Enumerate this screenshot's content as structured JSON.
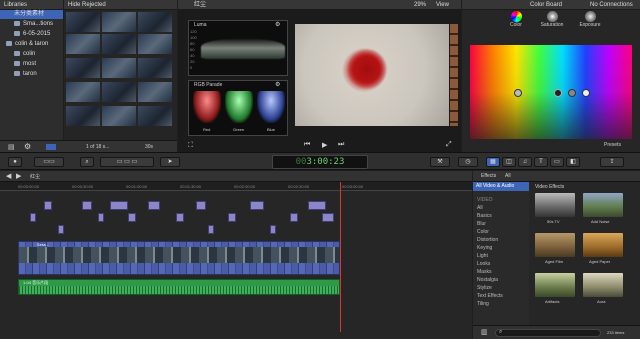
{
  "libraries": {
    "title": "Libraries",
    "items": [
      {
        "label": "未分类素材",
        "selected": true
      },
      {
        "label": "Sma...tions"
      },
      {
        "label": "Smart Collections"
      },
      {
        "label": "6-05-2015"
      },
      {
        "label": "colin & taron"
      },
      {
        "label": "colin"
      },
      {
        "label": "most"
      },
      {
        "label": "taron"
      }
    ]
  },
  "browser": {
    "filter": "Hide Rejected",
    "status": "1 of 18 s...",
    "duration": "30s"
  },
  "viewer": {
    "title": "红尘",
    "zoom": "29%",
    "view": "View",
    "luma_label": "Luma",
    "rgb_label": "RGB Parade",
    "scope_view": "View",
    "parade": [
      "Red",
      "Green",
      "Blue"
    ],
    "scale": [
      "120",
      "100",
      "80",
      "60",
      "40",
      "20",
      "0",
      "-20"
    ]
  },
  "color_board": {
    "title": "Color Board",
    "connections": "No Connections",
    "tabs": [
      "Color",
      "Saturation",
      "Exposure"
    ],
    "presets": "Presets"
  },
  "toolbar": {
    "timecode": "3:00:23",
    "timecode_prefix": "00",
    "timecode_labels": [
      "HR",
      "MIN",
      "SEC",
      "FR"
    ]
  },
  "timeline": {
    "project": "红尘",
    "ruler": [
      "00:00:00:00",
      "00:00:30:00",
      "00:01:00:00",
      "00:01:30:00",
      "00:02:00:00",
      "00:02:30:00",
      "00:03:00:00"
    ],
    "audio_label": "1-04 音乐片段",
    "clip_label": "Sess..."
  },
  "effects": {
    "title": "Effects",
    "filter": "All",
    "selected_cat": "All Video & Audio",
    "header": "Video Effects",
    "categories": [
      "VIDEO",
      "All",
      "Basics",
      "Blur",
      "Color",
      "Distortion",
      "Keying",
      "Light",
      "Looks",
      "Masks",
      "Nostalgia",
      "Stylize",
      "Text Effects",
      "Tiling"
    ],
    "items": [
      "50s TV",
      "Add Noise",
      "Aged Film",
      "Aged Paper",
      "Artifacts",
      "Aura"
    ],
    "count": "233 items"
  },
  "colors": {
    "accent": "#3d64b5",
    "timecode": "#6fd16f",
    "audio": "#2e9a47"
  }
}
